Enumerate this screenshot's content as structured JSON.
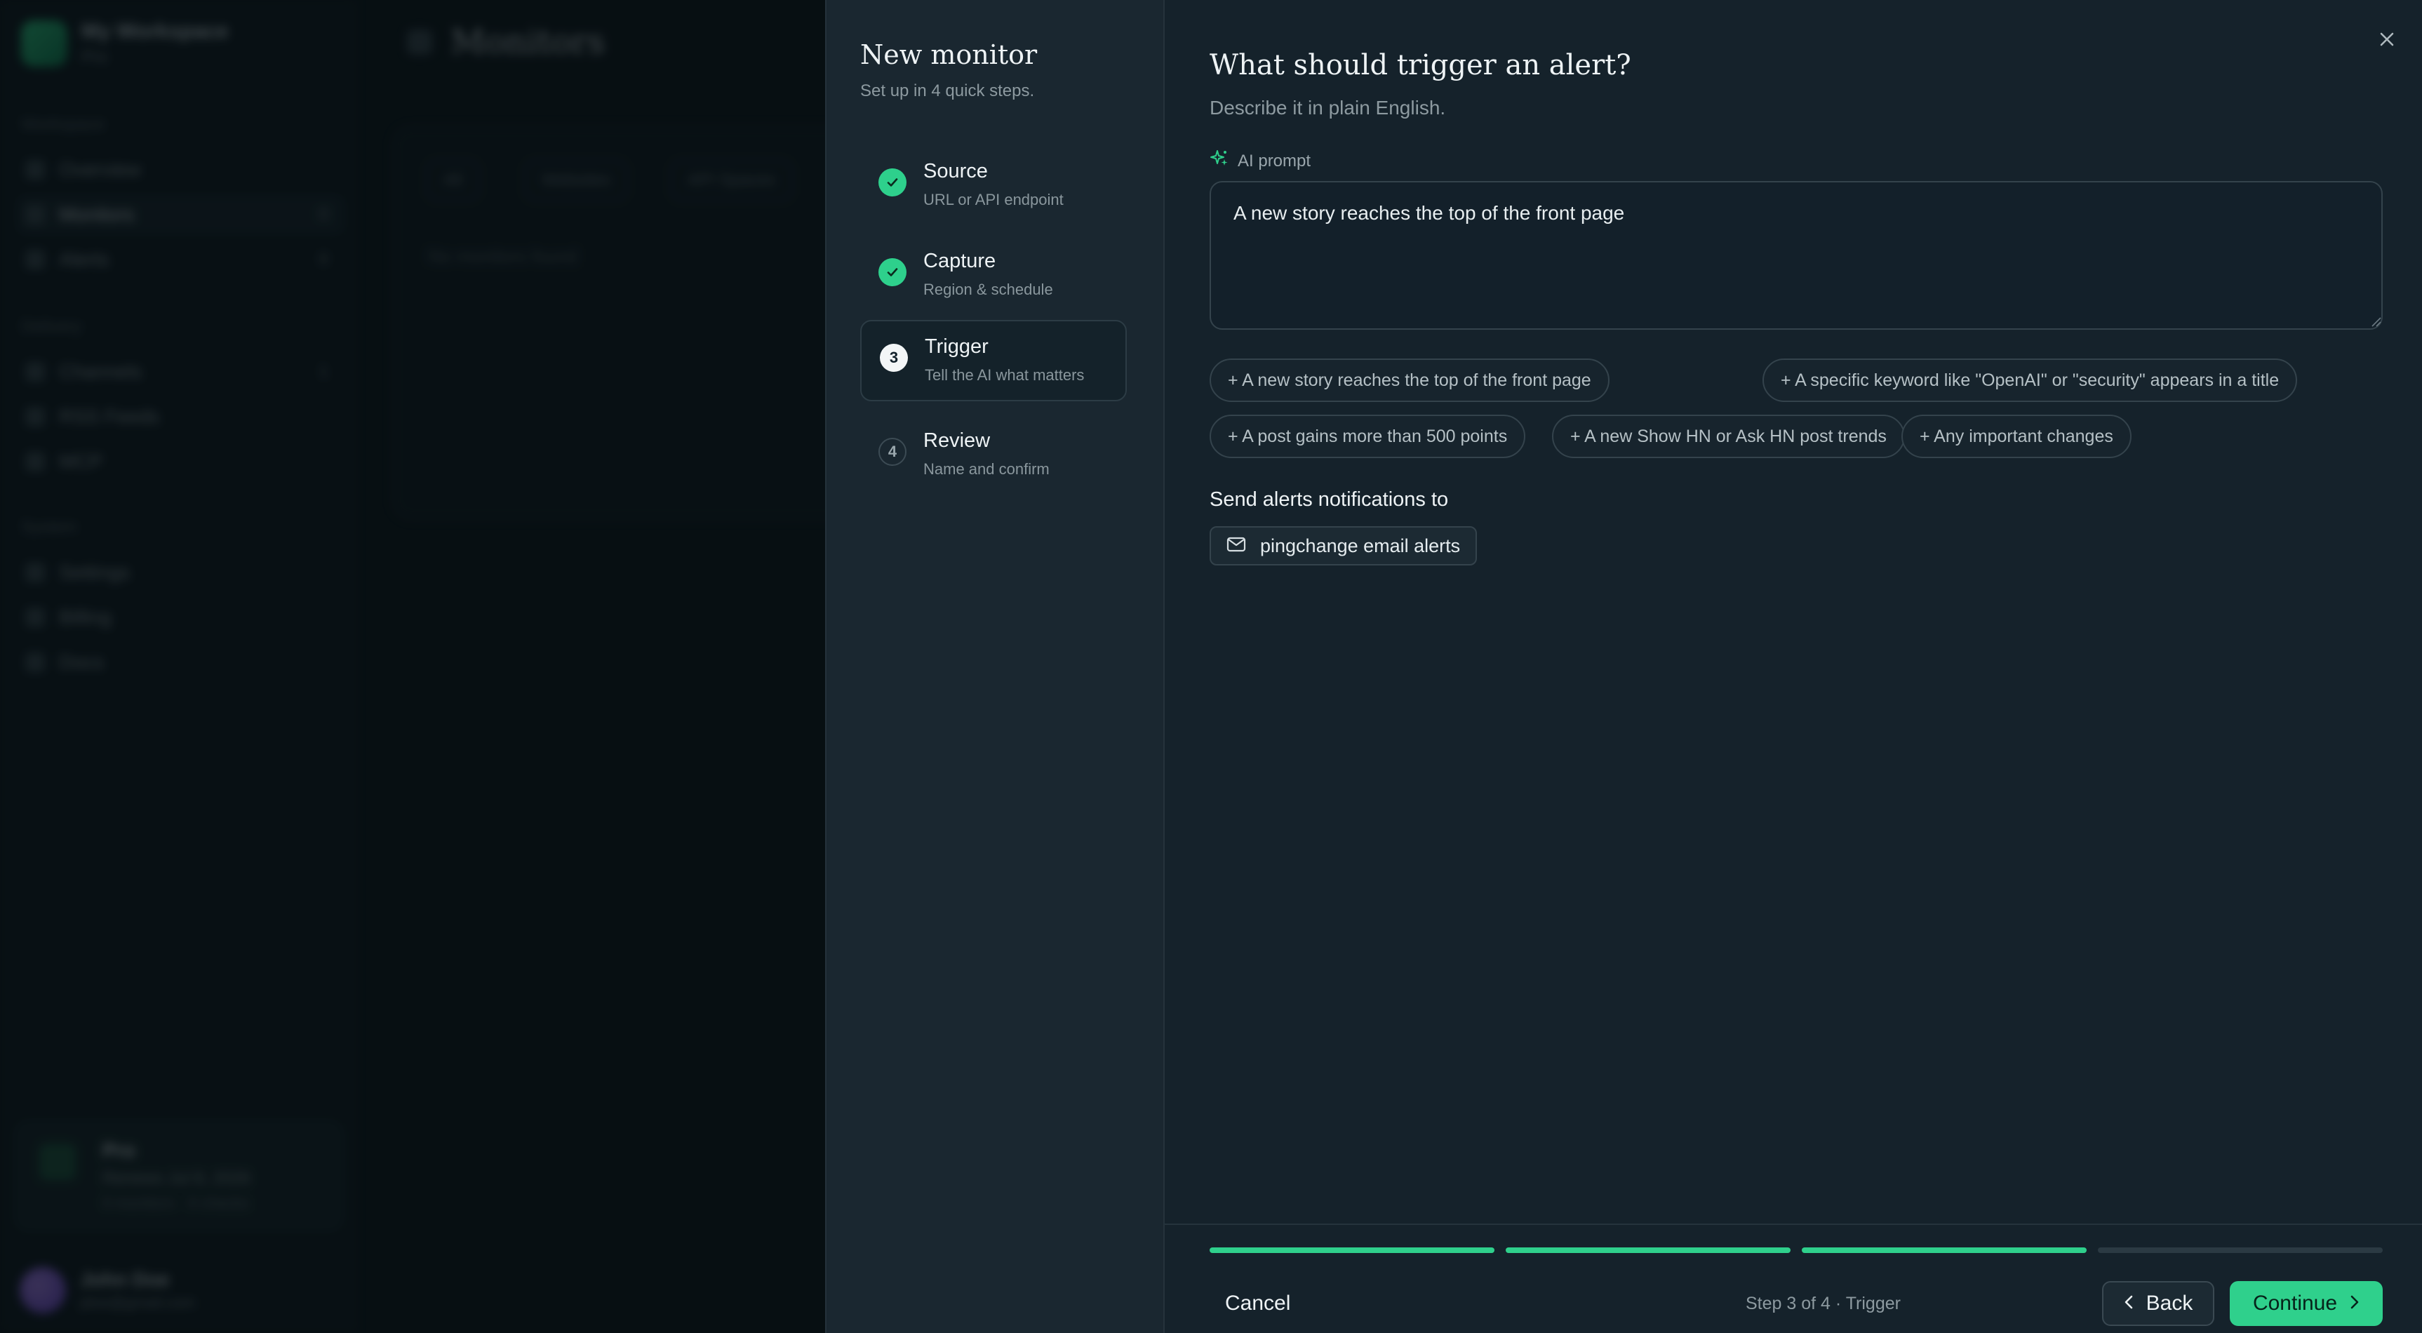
{
  "background": {
    "workspace": {
      "name": "My Workspace",
      "plan": "Pro"
    },
    "sections": {
      "workspace": "Workspace",
      "delivery": "Delivery",
      "system": "System"
    },
    "nav": [
      {
        "label": "Overview",
        "count": ""
      },
      {
        "label": "Monitors",
        "count": "0"
      },
      {
        "label": "Alerts",
        "count": "0"
      },
      {
        "label": "Channels",
        "count": "1"
      },
      {
        "label": "RSS Feeds",
        "count": ""
      },
      {
        "label": "MCP",
        "count": ""
      },
      {
        "label": "Settings",
        "count": ""
      },
      {
        "label": "Billing",
        "count": ""
      },
      {
        "label": "Docs",
        "count": ""
      }
    ],
    "plan_card": {
      "title": "Pro",
      "line1": "Renews Jul 8, 2026",
      "line2": "0 monitors · 0 checks"
    },
    "user": {
      "name": "John Doe",
      "email": "jdoe@gmail.com"
    },
    "page_title": "Monitors",
    "filters": [
      "All",
      "Websites",
      "API Spaces"
    ],
    "empty": "No monitors found"
  },
  "modal": {
    "title": "New monitor",
    "subtitle": "Set up in 4 quick steps.",
    "steps": [
      {
        "label": "Source",
        "sub": "URL or API endpoint",
        "state": "done",
        "num": "1"
      },
      {
        "label": "Capture",
        "sub": "Region & schedule",
        "state": "done",
        "num": "2"
      },
      {
        "label": "Trigger",
        "sub": "Tell the AI what matters",
        "state": "current",
        "num": "3"
      },
      {
        "label": "Review",
        "sub": "Name and confirm",
        "state": "todo",
        "num": "4"
      }
    ],
    "question": "What should trigger an alert?",
    "question_sub": "Describe it in plain English.",
    "ai_label": "AI prompt",
    "prompt_value": "A new story reaches the top of the front page",
    "suggestions": [
      "+ A new story reaches the top of the front page",
      "+ A specific keyword like \"OpenAI\" or \"security\" appears in a title",
      "+ A post gains more than 500 points",
      "+ A new Show HN or Ask HN post trends",
      "+ Any important changes"
    ],
    "send_title": "Send alerts notifications to",
    "destination": "pingchange email alerts",
    "progress": {
      "completed": 3,
      "total": 4
    },
    "cancel": "Cancel",
    "step_indicator": "Step 3 of 4 · Trigger",
    "back": "Back",
    "continue": "Continue",
    "colors": {
      "accent": "#2fd08c",
      "progress_inactive": "#2b3a43"
    }
  }
}
